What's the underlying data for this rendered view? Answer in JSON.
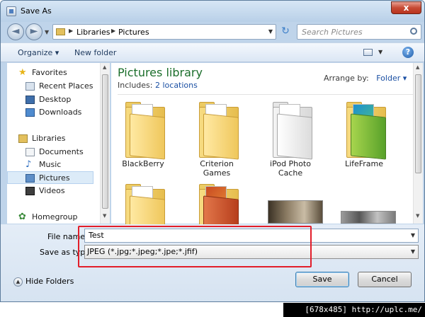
{
  "window": {
    "title": "Save As",
    "close_label": "x"
  },
  "nav": {
    "back_glyph": "◄",
    "forward_glyph": "►",
    "crumbs": [
      "Libraries",
      "Pictures"
    ],
    "search_placeholder": "Search Pictures"
  },
  "toolbar": {
    "organize_label": "Organize ▾",
    "new_folder_label": "New folder",
    "help_glyph": "?"
  },
  "sidebar": {
    "items": [
      {
        "label": "Favorites",
        "icon": "star-icon"
      },
      {
        "label": "Recent Places",
        "icon": "recent-places-icon"
      },
      {
        "label": "Desktop",
        "icon": "desktop-icon"
      },
      {
        "label": "Downloads",
        "icon": "downloads-icon"
      },
      {
        "label": "Libraries",
        "icon": "library-icon"
      },
      {
        "label": "Documents",
        "icon": "documents-icon"
      },
      {
        "label": "Music",
        "icon": "music-icon"
      },
      {
        "label": "Pictures",
        "icon": "pictures-icon",
        "selected": true
      },
      {
        "label": "Videos",
        "icon": "videos-icon"
      },
      {
        "label": "Homegroup",
        "icon": "homegroup-icon"
      }
    ]
  },
  "main": {
    "title": "Pictures library",
    "includes_label": "Includes:",
    "includes_link": "2 locations",
    "arrange_label": "Arrange by:",
    "arrange_value": "Folder",
    "folders": [
      {
        "name": "BlackBerry"
      },
      {
        "name": "Criterion Games"
      },
      {
        "name": "iPod Photo Cache"
      },
      {
        "name": "LifeFrame"
      }
    ]
  },
  "save": {
    "file_name_label": "File name:",
    "file_name_value": "Test",
    "save_type_label": "Save as type:",
    "save_type_value": "JPEG (*.jpg;*.jpeg;*.jpe;*.jfif)"
  },
  "footer": {
    "hide_folders_label": "Hide Folders",
    "save_label": "Save",
    "cancel_label": "Cancel"
  },
  "watermark": "[678x485] http://uplc.me/",
  "colors": {
    "highlight": "#e21e2a",
    "library_title": "#1b6e2b",
    "link": "#1a4fa3"
  }
}
